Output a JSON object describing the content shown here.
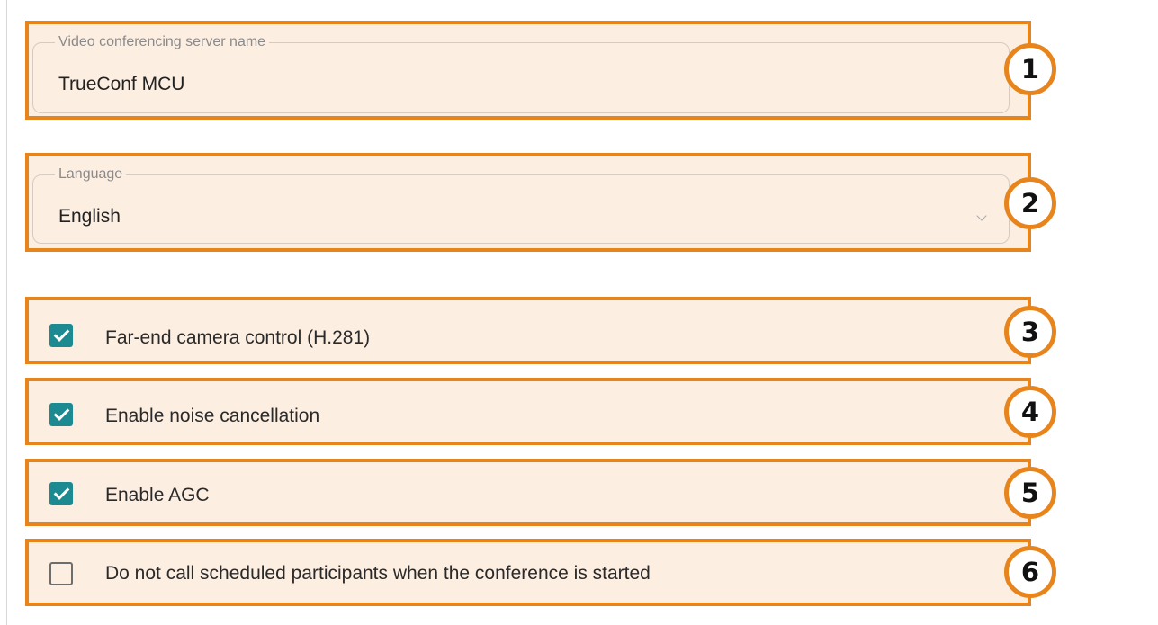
{
  "server_name": {
    "label": "Video conferencing server name",
    "value": "TrueConf MCU",
    "badge": "1"
  },
  "language": {
    "label": "Language",
    "value": "English",
    "badge": "2",
    "dropdown_icon": "chevron-down-icon"
  },
  "options": [
    {
      "label": "Far-end camera control (H.281)",
      "checked": true,
      "badge": "3"
    },
    {
      "label": "Enable noise cancellation",
      "checked": true,
      "badge": "4"
    },
    {
      "label": "Enable AGC",
      "checked": true,
      "badge": "5"
    },
    {
      "label": "Do not call scheduled participants when the conference is started",
      "checked": false,
      "badge": "6"
    }
  ],
  "colors": {
    "highlight_border": "#e8841c",
    "highlight_fill": "#fdeee2",
    "checkbox_checked": "#1d8a91"
  }
}
